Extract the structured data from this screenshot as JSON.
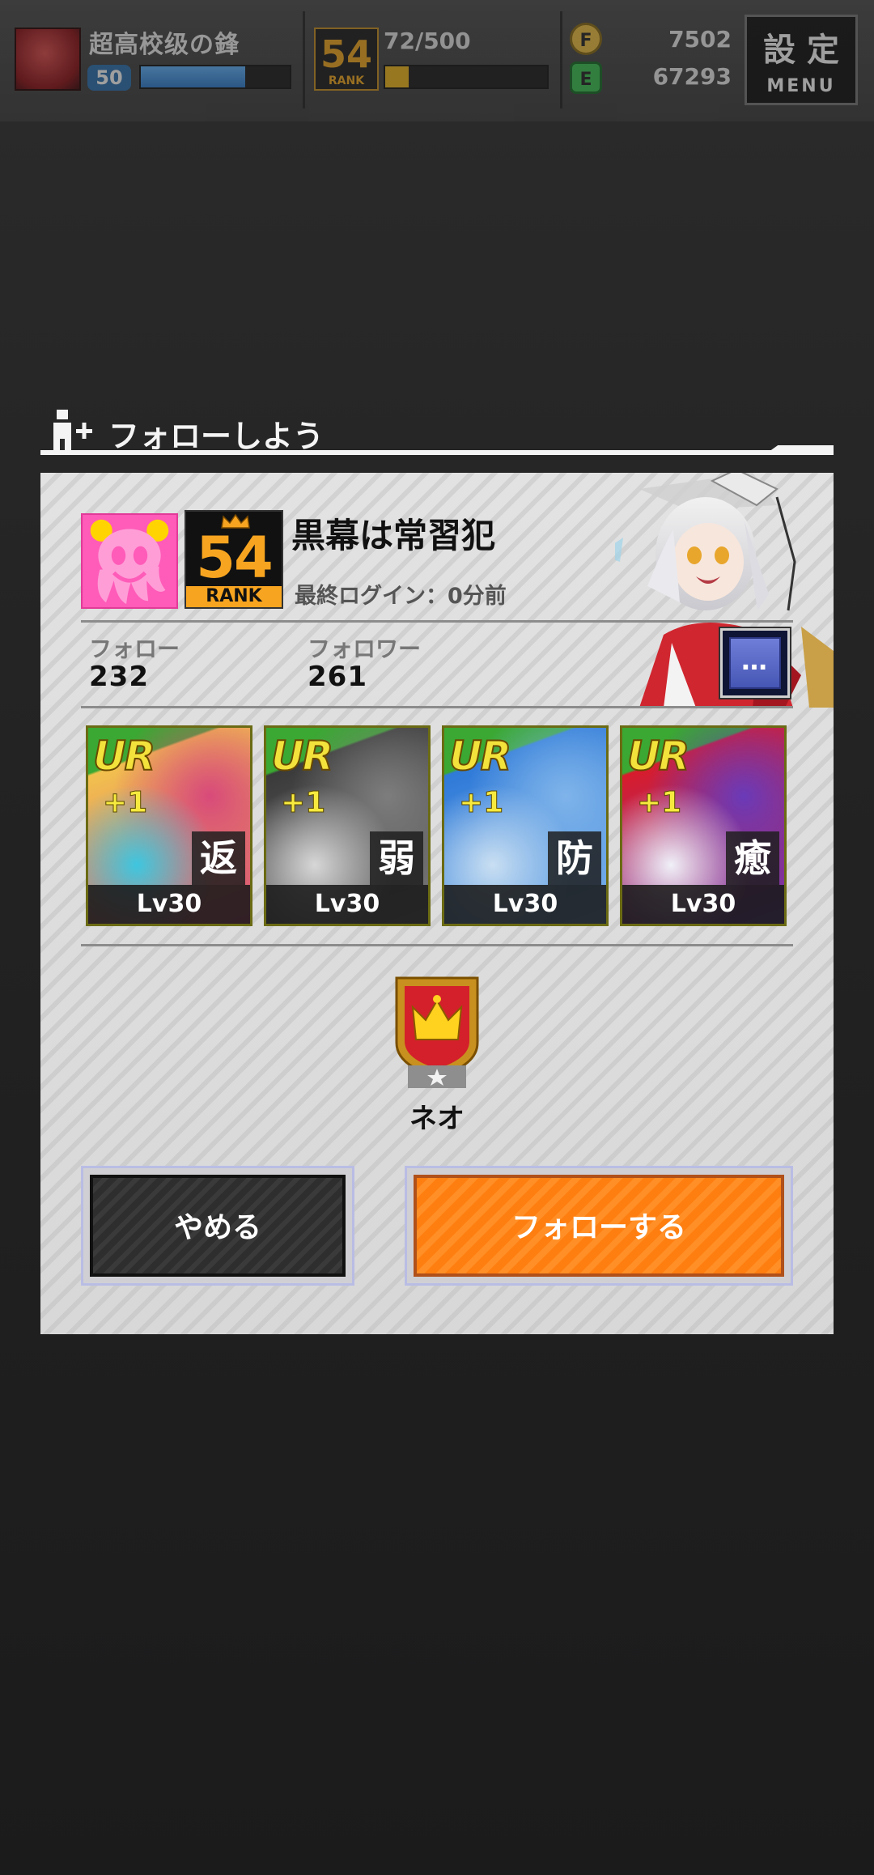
{
  "header": {
    "player_name": "超高校级の鋒",
    "player_level": "50",
    "exp_fraction": 0.7,
    "rank": {
      "number": "54",
      "label": "RANK"
    },
    "stamina": "72/500",
    "stamina_fraction": 0.144,
    "coin_f_icon": "F",
    "coin_e_icon": "E",
    "coins": "7502",
    "gems": "67293",
    "menu_button": {
      "kanji": "設定",
      "label": "MENU"
    }
  },
  "dialog": {
    "title": "フォローしよう",
    "friend": {
      "name": "黒幕は常習犯",
      "rank": {
        "number": "54",
        "label": "RANK"
      },
      "last_login": "最終ログイン：0分前",
      "follow_label": "フォロー",
      "follow_count": "232",
      "follower_label": "フォロワー",
      "follower_count": "261",
      "more_button": "…"
    },
    "cards": [
      {
        "rarity": "UR",
        "bonus": "+1",
        "attribute": "返",
        "level": "Lv30",
        "theme": [
          "#f2c14e",
          "#d84a7a",
          "#3ec6e0"
        ]
      },
      {
        "rarity": "UR",
        "bonus": "+1",
        "attribute": "弱",
        "level": "Lv30",
        "theme": [
          "#3a3a3a",
          "#7d7d7d",
          "#d7d7d7"
        ]
      },
      {
        "rarity": "UR",
        "bonus": "+1",
        "attribute": "防",
        "level": "Lv30",
        "theme": [
          "#2f7ad8",
          "#7fb4ea",
          "#c9dff2"
        ]
      },
      {
        "rarity": "UR",
        "bonus": "+1",
        "attribute": "癒",
        "level": "Lv30",
        "theme": [
          "#d81c2c",
          "#6a3ab8",
          "#f0f0f8"
        ]
      }
    ],
    "emblem_label": "ネオ",
    "cancel_button": "やめる",
    "follow_button": "フォローする"
  },
  "colors": {
    "accent_orange": "#ff8412",
    "rank_gold": "#f7a420",
    "panel_bg": "#dcdcdc"
  }
}
